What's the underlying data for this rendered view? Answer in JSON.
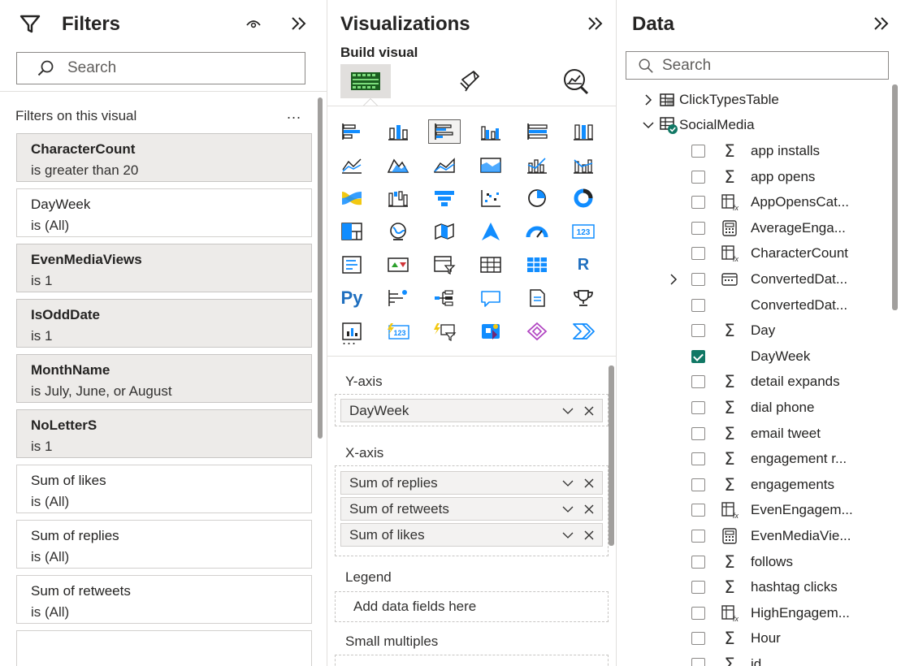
{
  "filters": {
    "title": "Filters",
    "search_placeholder": "Search",
    "section_label": "Filters on this visual",
    "more": "...",
    "cards": [
      {
        "name": "CharacterCount",
        "condition": "is greater than 20",
        "active": true
      },
      {
        "name": "DayWeek",
        "condition": "is (All)",
        "active": false
      },
      {
        "name": "EvenMediaViews",
        "condition": "is 1",
        "active": true
      },
      {
        "name": "IsOddDate",
        "condition": "is 1",
        "active": true
      },
      {
        "name": "MonthName",
        "condition": "is July, June, or August",
        "active": true
      },
      {
        "name": "NoLetterS",
        "condition": "is 1",
        "active": true
      },
      {
        "name": "Sum of likes",
        "condition": "is (All)",
        "active": false
      },
      {
        "name": "Sum of replies",
        "condition": "is (All)",
        "active": false
      },
      {
        "name": "Sum of retweets",
        "condition": "is (All)",
        "active": false
      }
    ]
  },
  "viz": {
    "title": "Visualizations",
    "build_label": "Build visual",
    "tabs": [
      "build-visual-icon",
      "format-visual-icon",
      "analytics-icon"
    ],
    "more": "...",
    "wells": {
      "y_axis": {
        "label": "Y-axis",
        "fields": [
          "DayWeek"
        ]
      },
      "x_axis": {
        "label": "X-axis",
        "fields": [
          "Sum of replies",
          "Sum of retweets",
          "Sum of likes"
        ]
      },
      "legend": {
        "label": "Legend",
        "placeholder": "Add data fields here"
      },
      "small_multiples": {
        "label": "Small multiples"
      }
    }
  },
  "data": {
    "title": "Data",
    "search_placeholder": "Search",
    "tables": [
      {
        "name": "ClickTypesTable",
        "expanded": false
      },
      {
        "name": "SocialMedia",
        "expanded": true
      }
    ],
    "fields": [
      {
        "name": "app installs",
        "icon": "sigma",
        "checked": false
      },
      {
        "name": "app opens",
        "icon": "sigma",
        "checked": false
      },
      {
        "name": "AppOpensCat...",
        "icon": "calc-column",
        "checked": false
      },
      {
        "name": "AverageEnga...",
        "icon": "measure",
        "checked": false
      },
      {
        "name": "CharacterCount",
        "icon": "calc-column",
        "checked": false
      },
      {
        "name": "ConvertedDat...",
        "icon": "date-hierarchy",
        "checked": false,
        "expander": true
      },
      {
        "name": "ConvertedDat...",
        "icon": "none",
        "checked": false
      },
      {
        "name": "Day",
        "icon": "sigma",
        "checked": false
      },
      {
        "name": "DayWeek",
        "icon": "none",
        "checked": true
      },
      {
        "name": "detail expands",
        "icon": "sigma",
        "checked": false
      },
      {
        "name": "dial phone",
        "icon": "sigma",
        "checked": false
      },
      {
        "name": "email tweet",
        "icon": "sigma",
        "checked": false
      },
      {
        "name": "engagement r...",
        "icon": "sigma",
        "checked": false
      },
      {
        "name": "engagements",
        "icon": "sigma",
        "checked": false
      },
      {
        "name": "EvenEngagem...",
        "icon": "calc-column",
        "checked": false
      },
      {
        "name": "EvenMediaVie...",
        "icon": "measure",
        "checked": false
      },
      {
        "name": "follows",
        "icon": "sigma",
        "checked": false
      },
      {
        "name": "hashtag clicks",
        "icon": "sigma",
        "checked": false
      },
      {
        "name": "HighEngagem...",
        "icon": "calc-column",
        "checked": false
      },
      {
        "name": "Hour",
        "icon": "sigma",
        "checked": false
      },
      {
        "name": "id",
        "icon": "sigma",
        "checked": false
      }
    ]
  },
  "colors": {
    "accent": "#117865",
    "text": "#252423",
    "border": "#d2d0ce"
  }
}
